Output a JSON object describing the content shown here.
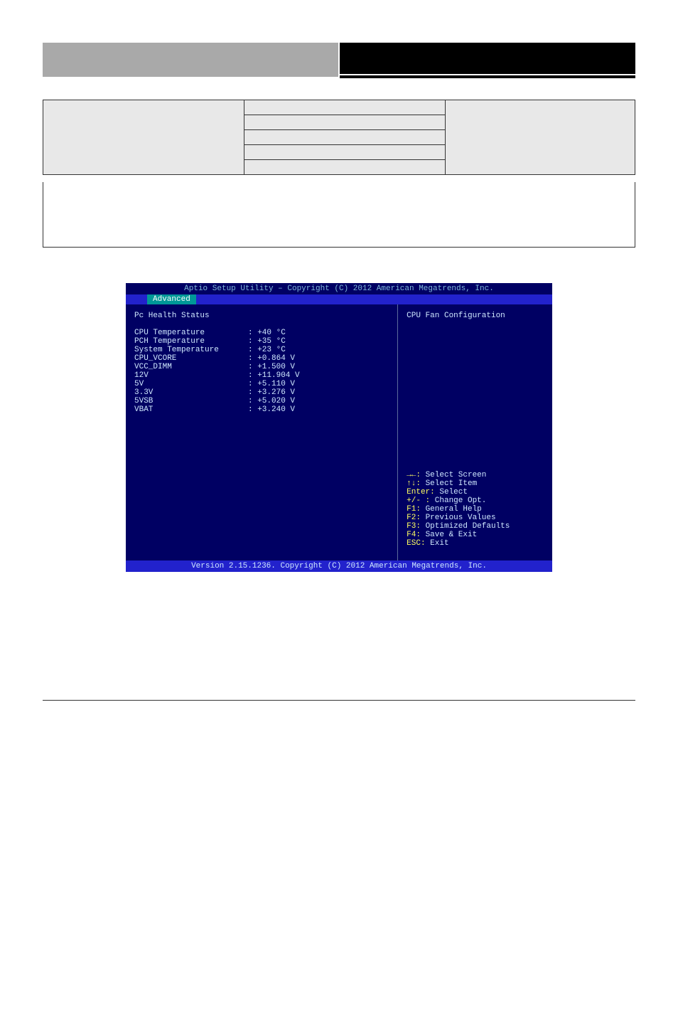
{
  "spec_row": {
    "label": "",
    "options": [
      "",
      "",
      "",
      "",
      ""
    ],
    "desc": ""
  },
  "content_note": "",
  "bios": {
    "top": "Aptio Setup Utility – Copyright (C) 2012 American Megatrends, Inc.",
    "menu": {
      "advanced": "Advanced"
    },
    "title": "Pc Health Status",
    "help_right": "CPU Fan Configuration",
    "rows": [
      {
        "k": "CPU Temperature",
        "v": ": +40 °C"
      },
      {
        "k": "PCH Temperature",
        "v": ": +35 °C"
      },
      {
        "k": "System Temperature",
        "v": ": +23 °C"
      },
      {
        "k": "CPU_VCORE",
        "v": ": +0.864 V"
      },
      {
        "k": "VCC_DIMM",
        "v": ": +1.500 V"
      },
      {
        "k": "12V",
        "v": ": +11.904 V"
      },
      {
        "k": "5V",
        "v": ": +5.110 V"
      },
      {
        "k": "3.3V",
        "v": ": +3.276 V"
      },
      {
        "k": "5VSB",
        "v": ": +5.020 V"
      },
      {
        "k": "VBAT",
        "v": ": +3.240 V"
      }
    ],
    "help": [
      {
        "accent": "→←:",
        "text": " Select Screen"
      },
      {
        "accent": "↑↓:",
        "text": " Select Item"
      },
      {
        "accent": "Enter:",
        "text": " Select"
      },
      {
        "accent": "+/- :",
        "text": " Change Opt."
      },
      {
        "accent": "F1:",
        "text": " General Help"
      },
      {
        "accent": "F2:",
        "text": " Previous Values"
      },
      {
        "accent": "F3:",
        "text": " Optimized Defaults"
      },
      {
        "accent": "F4:",
        "text": " Save & Exit"
      },
      {
        "accent": "ESC:",
        "text": " Exit"
      }
    ],
    "bottom": "Version 2.15.1236. Copyright (C) 2012 American Megatrends, Inc."
  },
  "footer": {
    "left": "",
    "right": ""
  }
}
